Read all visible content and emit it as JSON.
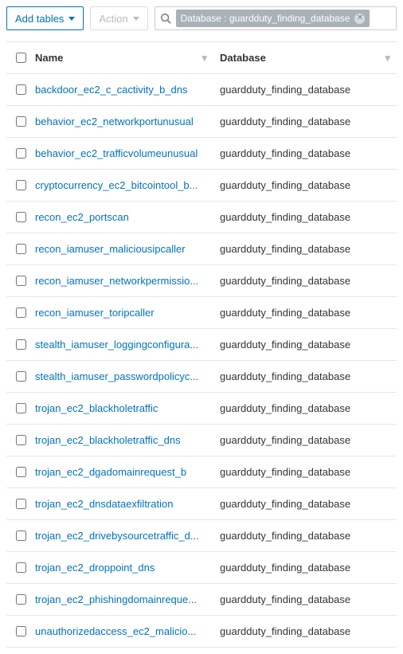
{
  "toolbar": {
    "add_tables_label": "Add tables",
    "action_label": "Action"
  },
  "search": {
    "filter_chip": "Database : guardduty_finding_database"
  },
  "columns": {
    "name": "Name",
    "database": "Database"
  },
  "rows": [
    {
      "name": "backdoor_ec2_c_cactivity_b_dns",
      "database": "guardduty_finding_database"
    },
    {
      "name": "behavior_ec2_networkportunusual",
      "database": "guardduty_finding_database"
    },
    {
      "name": "behavior_ec2_trafficvolumeunusual",
      "database": "guardduty_finding_database"
    },
    {
      "name": "cryptocurrency_ec2_bitcointool_b...",
      "database": "guardduty_finding_database"
    },
    {
      "name": "recon_ec2_portscan",
      "database": "guardduty_finding_database"
    },
    {
      "name": "recon_iamuser_maliciousipcaller",
      "database": "guardduty_finding_database"
    },
    {
      "name": "recon_iamuser_networkpermissio...",
      "database": "guardduty_finding_database"
    },
    {
      "name": "recon_iamuser_toripcaller",
      "database": "guardduty_finding_database"
    },
    {
      "name": "stealth_iamuser_loggingconfigura...",
      "database": "guardduty_finding_database"
    },
    {
      "name": "stealth_iamuser_passwordpolicyc...",
      "database": "guardduty_finding_database"
    },
    {
      "name": "trojan_ec2_blackholetraffic",
      "database": "guardduty_finding_database"
    },
    {
      "name": "trojan_ec2_blackholetraffic_dns",
      "database": "guardduty_finding_database"
    },
    {
      "name": "trojan_ec2_dgadomainrequest_b",
      "database": "guardduty_finding_database"
    },
    {
      "name": "trojan_ec2_dnsdataexfiltration",
      "database": "guardduty_finding_database"
    },
    {
      "name": "trojan_ec2_drivebysourcetraffic_d...",
      "database": "guardduty_finding_database"
    },
    {
      "name": "trojan_ec2_droppoint_dns",
      "database": "guardduty_finding_database"
    },
    {
      "name": "trojan_ec2_phishingdomainreque...",
      "database": "guardduty_finding_database"
    },
    {
      "name": "unauthorizedaccess_ec2_malicio...",
      "database": "guardduty_finding_database"
    }
  ]
}
